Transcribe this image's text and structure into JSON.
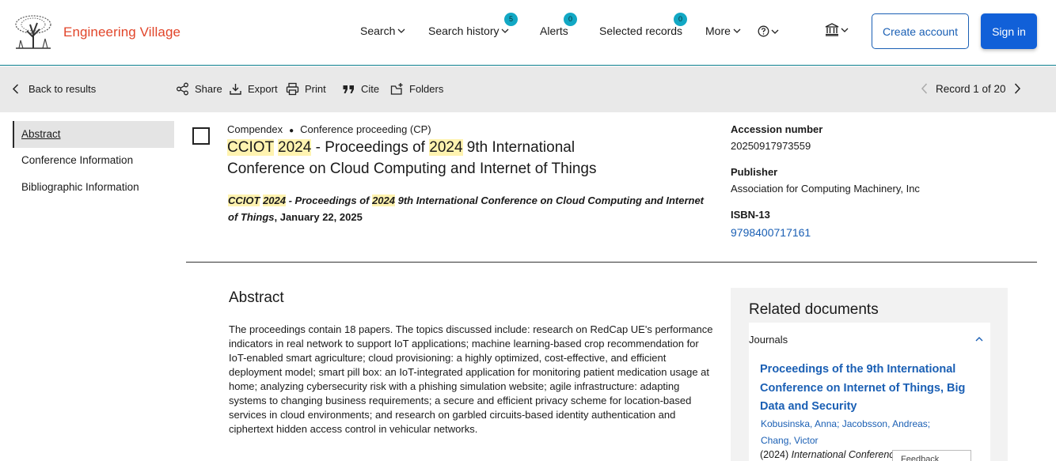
{
  "header": {
    "brand": "Engineering Village",
    "nav": {
      "search": "Search",
      "search_history": "Search history",
      "search_history_count": "5",
      "alerts": "Alerts",
      "alerts_count": "0",
      "selected_records": "Selected records",
      "selected_records_count": "0",
      "more": "More"
    },
    "create_account": "Create account",
    "sign_in": "Sign in"
  },
  "toolbar": {
    "back": "Back to results",
    "share": "Share",
    "export": "Export",
    "print": "Print",
    "cite": "Cite",
    "folders": "Folders",
    "record_position": "Record 1 of 20"
  },
  "sidenav": {
    "items": [
      {
        "label": "Abstract",
        "active": true
      },
      {
        "label": "Conference Information",
        "active": false
      },
      {
        "label": "Bibliographic Information",
        "active": false
      }
    ]
  },
  "record": {
    "database": "Compendex",
    "doc_type": "Conference proceeding (CP)",
    "title_parts": [
      "CCIOT",
      " ",
      "2024",
      " - Proceedings of ",
      "2024",
      " 9th International Conference on Cloud Computing and Internet of Things"
    ],
    "source_parts": [
      "CCIOT",
      " ",
      "2024",
      " - Proceedings of ",
      "2024",
      " 9th International Conference on Cloud Computing and Internet of Things"
    ],
    "source_date": ", January 22, 2025"
  },
  "facts": {
    "accession_label": "Accession number",
    "accession_value": "20250917973559",
    "publisher_label": "Publisher",
    "publisher_value": "Association for Computing Machinery, Inc",
    "isbn_label": "ISBN-13",
    "isbn_value": "9798400717161"
  },
  "abstract": {
    "heading": "Abstract",
    "text": "The proceedings contain 18 papers. The topics discussed include: research on RedCap UE's performance indicators in real network to support IoT applications; machine learning-based crop recommendation for IoT-enabled smart agriculture; cloud provisioning: a highly optimized, cost-effective, and efficient deployment model; smart pill box: an IoT-integrated application for monitoring patient medication usage at home; analyzing cybersecurity risk with a phishing simulation website; agile infrastructure: adapting systems to changing business requirements; a secure and efficient privacy scheme for location-based services in cloud environments; and research on garbled circuits-based identity authentication and ciphertext hidden access control in vehicular networks."
  },
  "related": {
    "heading": "Related documents",
    "group": "Journals",
    "item_title": "Proceedings of the 9th International Conference on Internet of Things, Big Data and Security",
    "item_authors": "Kobusinska, Anna; Jacobsson, Andreas; Chang, Victor",
    "item_year": "(2024) ",
    "item_source": "International Conference of",
    "feedback": "Feedback"
  },
  "colors": {
    "brand": "#e1452a",
    "link": "#1a5fb4",
    "primary_button": "#1160d8",
    "badge": "#12a8c4",
    "highlight": "#fff3b0",
    "toolbar_bg": "#e9e9e9"
  }
}
